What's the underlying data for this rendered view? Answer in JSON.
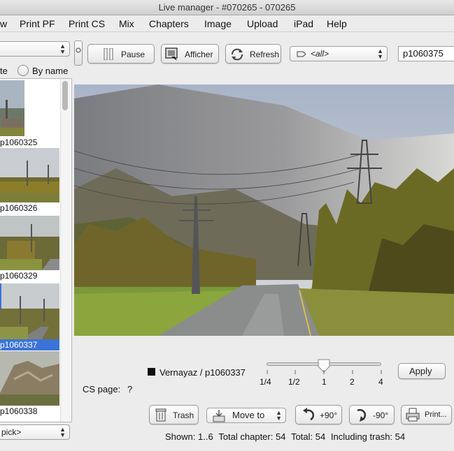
{
  "window": {
    "title": "Live manager - #070265 - 070265"
  },
  "menu": [
    "w",
    "Print PF",
    "Print CS",
    "Mix",
    "Chapters",
    "Image",
    "Upload",
    "iPad",
    "Help"
  ],
  "toolbar": {
    "pause_label": "Pause",
    "afficher_label": "Afficher",
    "refresh_label": "Refresh",
    "filter_value": "<all>",
    "photo_field": "p1060375"
  },
  "sort": {
    "left_label": "te",
    "by_name_label": "By name"
  },
  "thumbnails": [
    {
      "caption": "p1060325"
    },
    {
      "caption": "p1060326"
    },
    {
      "caption": "p1060329"
    },
    {
      "caption": "p1060337"
    },
    {
      "caption": "p1060338"
    }
  ],
  "pick_select": "pick>",
  "caption_text": "Vernayaz / p1060337",
  "slider": {
    "ticks": [
      "1/4",
      "1/2",
      "1",
      "2",
      "4"
    ],
    "value": 1
  },
  "apply_label": "Apply",
  "cs_page": {
    "label": "CS page:",
    "value": "?"
  },
  "bottom": {
    "trash_label": "Trash",
    "move_to_label": "Move to",
    "rot_plus_label": "+90°",
    "rot_minus_label": "-90°",
    "print_label": "Print..."
  },
  "status": {
    "shown_label": "Shown:",
    "shown_value": "1..6",
    "total_chapter_label": "Total chapter:",
    "total_chapter_value": "54",
    "total_label": "Total:",
    "total_value": "54",
    "including_trash_label": "Including trash:",
    "including_trash_value": "54"
  }
}
